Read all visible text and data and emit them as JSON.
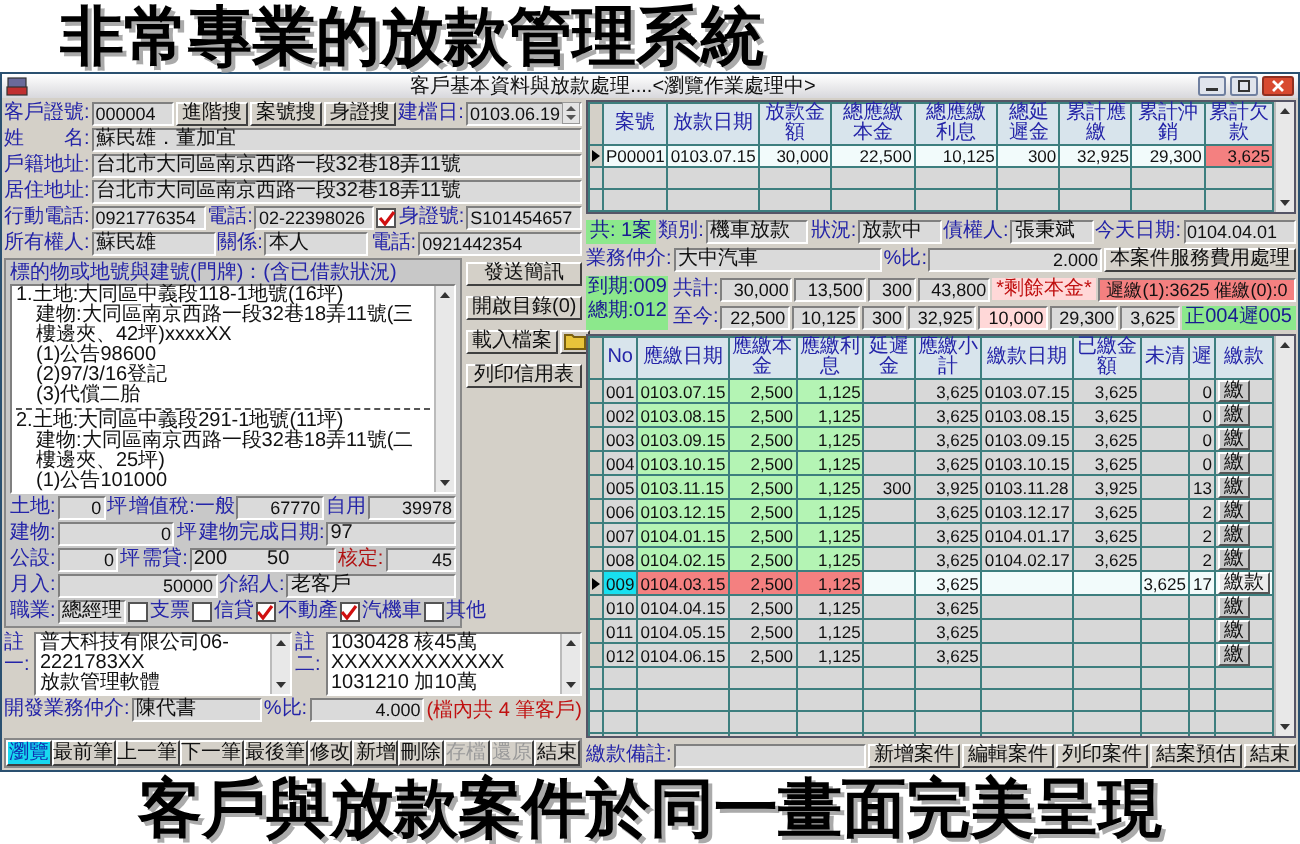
{
  "headline": "非常專業的放款管理系統",
  "window": {
    "title": "客戶基本資料與放款處理....<瀏覽作業處理中>"
  },
  "customer": {
    "rows": [
      [
        {
          "kind": "label",
          "text": "客戶證號:"
        },
        {
          "kind": "code",
          "value": "000004"
        },
        {
          "kind": "button",
          "text": "進階搜"
        },
        {
          "kind": "button",
          "text": "案號搜"
        },
        {
          "kind": "button",
          "text": "身證搜"
        },
        {
          "kind": "label",
          "text": "建檔日:"
        },
        {
          "kind": "spin",
          "value": "0103.06.19"
        }
      ],
      [
        {
          "kind": "label",
          "text": "姓　　名:"
        },
        {
          "kind": "field",
          "value": "蘇民雄．董加宜"
        }
      ],
      [
        {
          "kind": "label",
          "text": "戶籍地址:"
        },
        {
          "kind": "field",
          "value": "台北市大同區南京西路一段32巷18弄11號"
        }
      ],
      [
        {
          "kind": "label",
          "text": "居住地址:"
        },
        {
          "kind": "field",
          "value": "台北市大同區南京西路一段32巷18弄11號"
        }
      ],
      [
        {
          "kind": "label",
          "text": "行動電話:"
        },
        {
          "kind": "code",
          "value": "0921776354"
        },
        {
          "kind": "label",
          "text": "電話:"
        },
        {
          "kind": "code",
          "value": "02-22398026"
        },
        {
          "kind": "check",
          "checked": true
        },
        {
          "kind": "label",
          "text": "身證號:"
        },
        {
          "kind": "code",
          "value": "S101454657"
        }
      ],
      [
        {
          "kind": "label",
          "text": "所有權人:"
        },
        {
          "kind": "field",
          "value": "蘇民雄"
        },
        {
          "kind": "label",
          "text": "關係:"
        },
        {
          "kind": "field",
          "value": "本人"
        },
        {
          "kind": "label",
          "text": "電話:"
        },
        {
          "kind": "code",
          "value": "0921442354"
        }
      ]
    ],
    "property": {
      "title": "標的物或地號與建號(門牌)：(含已借款狀況)",
      "entries": [
        [
          "1.土地:大同區中義段118-1地號(16坪)",
          "建物:大同區南京西路一段32巷18弄11號(三樓邊夾、42坪)xxxxXX",
          "(1)公告98600",
          "(2)97/3/16登記",
          "(3)代償二胎"
        ],
        [
          "2.土地:大同區中義段291-1地號(11坪)",
          "建物:大同區南京西路一段32巷18弄11號(二樓邊夾、25坪)",
          "(1)公告101000"
        ]
      ]
    },
    "side_buttons": [
      [
        {
          "kind": "button",
          "text": "發送簡訊"
        }
      ],
      [
        {
          "kind": "button",
          "text": "開啟目錄(0)"
        }
      ],
      [
        {
          "kind": "button",
          "text": "載入檔案"
        },
        {
          "kind": "folder"
        }
      ],
      [
        {
          "kind": "button",
          "text": "列印信用表"
        }
      ]
    ],
    "details": [
      [
        {
          "kind": "label",
          "text": "土地:"
        },
        {
          "kind": "num",
          "value": "0"
        },
        {
          "kind": "label",
          "text": "坪"
        },
        {
          "kind": "label",
          "text": "增值稅:一般"
        },
        {
          "kind": "num",
          "value": "67770"
        },
        {
          "kind": "label",
          "text": "自用"
        },
        {
          "kind": "num",
          "value": "39978"
        }
      ],
      [
        {
          "kind": "label",
          "text": "建物:"
        },
        {
          "kind": "num",
          "value": "0"
        },
        {
          "kind": "label",
          "text": "坪"
        },
        {
          "kind": "label",
          "text": "建物完成日期:"
        },
        {
          "kind": "field",
          "value": "97"
        }
      ],
      [
        {
          "kind": "label",
          "text": "公設:"
        },
        {
          "kind": "num",
          "value": "0"
        },
        {
          "kind": "label",
          "text": "坪"
        },
        {
          "kind": "label",
          "text": "需貸:"
        },
        {
          "kind": "field",
          "value": "200　　50"
        },
        {
          "kind": "alert-label",
          "text": "核定:"
        },
        {
          "kind": "num",
          "value": "45"
        }
      ],
      [
        {
          "kind": "label",
          "text": "月入:"
        },
        {
          "kind": "num",
          "value": "50000"
        },
        {
          "kind": "label",
          "text": "介紹人:"
        },
        {
          "kind": "field",
          "value": "老客戶"
        }
      ],
      [
        {
          "kind": "label",
          "text": "職業:"
        },
        {
          "kind": "field",
          "value": "總經理"
        },
        {
          "kind": "check",
          "checked": false,
          "text": "支票"
        },
        {
          "kind": "check",
          "checked": false,
          "text": "信貸"
        },
        {
          "kind": "check",
          "checked": true,
          "text": "不動產"
        },
        {
          "kind": "check",
          "checked": true,
          "text": "汽機車"
        },
        {
          "kind": "check",
          "checked": false,
          "text": "其他"
        }
      ]
    ],
    "notes": [
      {
        "label": "註一:",
        "lines": [
          "普大科技有限公司06-2221783XX",
          "放款管理軟體"
        ]
      },
      {
        "label": "註二:",
        "lines": [
          "1030428 核45萬 XXXXXXXXXXXXX",
          "1031210 加10萬"
        ]
      }
    ],
    "broker_row": [
      {
        "kind": "label",
        "text": "開發業務仲介:"
      },
      {
        "kind": "field",
        "value": "陳代書"
      },
      {
        "kind": "label",
        "text": "%比:"
      },
      {
        "kind": "num",
        "value": "4.000"
      },
      {
        "kind": "note",
        "text": "(檔內共 4 筆客戶)"
      }
    ],
    "nav_buttons": [
      {
        "label": "瀏覽",
        "selected": true,
        "disabled": false
      },
      {
        "label": "最前筆",
        "selected": false,
        "disabled": false
      },
      {
        "label": "上一筆",
        "selected": false,
        "disabled": false
      },
      {
        "label": "下一筆",
        "selected": false,
        "disabled": false
      },
      {
        "label": "最後筆",
        "selected": false,
        "disabled": false
      },
      {
        "label": "修改",
        "selected": false,
        "disabled": false
      },
      {
        "label": "新增",
        "selected": false,
        "disabled": false
      },
      {
        "label": "刪除",
        "selected": false,
        "disabled": false
      },
      {
        "label": "存檔",
        "selected": false,
        "disabled": true
      },
      {
        "label": "還原",
        "selected": false,
        "disabled": true
      },
      {
        "label": "結束",
        "selected": false,
        "disabled": false
      }
    ]
  },
  "cases": {
    "columns": [
      "案號",
      "放款日期",
      "放款金額",
      "總應繳本金",
      "總應繳利息",
      "總延遲金",
      "累計應繳",
      "累計沖銷",
      "累計欠款"
    ],
    "rows": [
      {
        "cells": [
          "P00001",
          "0103.07.15",
          "30,000",
          "22,500",
          "10,125",
          "300",
          "32,925",
          "29,300",
          "3,625"
        ],
        "selected": true,
        "in_arrears": true
      }
    ]
  },
  "case_info": [
    [
      {
        "kind": "count",
        "text": "共: 1案"
      },
      {
        "kind": "label",
        "text": "類別:"
      },
      {
        "kind": "field",
        "value": "機車放款"
      },
      {
        "kind": "label",
        "text": "狀況:"
      },
      {
        "kind": "field",
        "value": "放款中"
      },
      {
        "kind": "label",
        "text": "債權人:"
      },
      {
        "kind": "field",
        "value": "張秉斌"
      },
      {
        "kind": "label",
        "text": "今天日期:"
      },
      {
        "kind": "code",
        "value": "0104.04.01"
      }
    ],
    [
      {
        "kind": "label",
        "text": "業務仲介:"
      },
      {
        "kind": "field",
        "value": "大中汽車"
      },
      {
        "kind": "label",
        "text": "%比:"
      },
      {
        "kind": "num",
        "value": "2.000"
      },
      {
        "kind": "button",
        "text": "本案件服務費用處理"
      }
    ]
  ],
  "totals": {
    "period": [
      "到期:009",
      "總期:012"
    ],
    "rows": [
      [
        {
          "kind": "label",
          "text": "共計:"
        },
        {
          "kind": "num",
          "value": "30,000"
        },
        {
          "kind": "num",
          "value": "13,500"
        },
        {
          "kind": "num",
          "value": "300"
        },
        {
          "kind": "num",
          "value": "43,800"
        },
        {
          "kind": "pink-label",
          "text": "*剩餘本金*"
        },
        {
          "kind": "alert",
          "value": "遲繳(1):3625 催繳(0):0"
        }
      ],
      [
        {
          "kind": "label",
          "text": "至今:"
        },
        {
          "kind": "num",
          "value": "22,500"
        },
        {
          "kind": "num",
          "value": "10,125"
        },
        {
          "kind": "num",
          "value": "300"
        },
        {
          "kind": "num",
          "value": "32,925"
        },
        {
          "kind": "pink",
          "value": "10,000"
        },
        {
          "kind": "num",
          "value": "29,300"
        },
        {
          "kind": "num",
          "value": "3,625"
        },
        {
          "kind": "count",
          "text": "正004遲005"
        }
      ]
    ]
  },
  "schedule": {
    "columns": [
      "No",
      "應繳日期",
      "應繳本金",
      "應繳利息",
      "延遲金",
      "應繳小計",
      "繳款日期",
      "已繳金額",
      "未清",
      "遲",
      "繳款"
    ],
    "rows": [
      {
        "no": "001",
        "due_date": "0103.07.15",
        "principal": "2,500",
        "interest": "1,125",
        "subtotal": "3,625",
        "paid_date": "0103.07.15",
        "paid_amount": "3,625",
        "late_days": "0",
        "button": "繳",
        "paid": true,
        "selected": false
      },
      {
        "no": "002",
        "due_date": "0103.08.15",
        "principal": "2,500",
        "interest": "1,125",
        "subtotal": "3,625",
        "paid_date": "0103.08.15",
        "paid_amount": "3,625",
        "late_days": "0",
        "button": "繳",
        "paid": true,
        "selected": false
      },
      {
        "no": "003",
        "due_date": "0103.09.15",
        "principal": "2,500",
        "interest": "1,125",
        "subtotal": "3,625",
        "paid_date": "0103.09.15",
        "paid_amount": "3,625",
        "late_days": "0",
        "button": "繳",
        "paid": true,
        "selected": false
      },
      {
        "no": "004",
        "due_date": "0103.10.15",
        "principal": "2,500",
        "interest": "1,125",
        "subtotal": "3,625",
        "paid_date": "0103.10.15",
        "paid_amount": "3,625",
        "late_days": "0",
        "button": "繳",
        "paid": true,
        "selected": false
      },
      {
        "no": "005",
        "due_date": "0103.11.15",
        "principal": "2,500",
        "interest": "1,125",
        "late_fee": "300",
        "subtotal": "3,925",
        "paid_date": "0103.11.28",
        "paid_amount": "3,925",
        "late_days": "13",
        "button": "繳",
        "paid": true,
        "selected": false
      },
      {
        "no": "006",
        "due_date": "0103.12.15",
        "principal": "2,500",
        "interest": "1,125",
        "subtotal": "3,625",
        "paid_date": "0103.12.17",
        "paid_amount": "3,625",
        "late_days": "2",
        "button": "繳",
        "paid": true,
        "selected": false
      },
      {
        "no": "007",
        "due_date": "0104.01.15",
        "principal": "2,500",
        "interest": "1,125",
        "subtotal": "3,625",
        "paid_date": "0104.01.17",
        "paid_amount": "3,625",
        "late_days": "2",
        "button": "繳",
        "paid": true,
        "selected": false
      },
      {
        "no": "008",
        "due_date": "0104.02.15",
        "principal": "2,500",
        "interest": "1,125",
        "subtotal": "3,625",
        "paid_date": "0104.02.17",
        "paid_amount": "3,625",
        "late_days": "2",
        "button": "繳",
        "paid": true,
        "selected": false
      },
      {
        "no": "009",
        "due_date": "0104.03.15",
        "principal": "2,500",
        "interest": "1,125",
        "subtotal": "3,625",
        "outstanding": "3,625",
        "late_days": "17",
        "button": "繳款",
        "paid": false,
        "selected": true
      },
      {
        "no": "010",
        "due_date": "0104.04.15",
        "principal": "2,500",
        "interest": "1,125",
        "subtotal": "3,625",
        "button": "繳",
        "paid": false,
        "selected": false
      },
      {
        "no": "011",
        "due_date": "0104.05.15",
        "principal": "2,500",
        "interest": "1,125",
        "subtotal": "3,625",
        "button": "繳",
        "paid": false,
        "selected": false
      },
      {
        "no": "012",
        "due_date": "0104.06.15",
        "principal": "2,500",
        "interest": "1,125",
        "subtotal": "3,625",
        "button": "繳",
        "paid": false,
        "selected": false
      }
    ]
  },
  "footer": [
    {
      "kind": "label",
      "text": "繳款備註:"
    },
    {
      "kind": "field"
    },
    {
      "kind": "button",
      "text": "新增案件"
    },
    {
      "kind": "button",
      "text": "編輯案件"
    },
    {
      "kind": "button",
      "text": "列印案件"
    },
    {
      "kind": "button",
      "text": "結案預估"
    },
    {
      "kind": "button",
      "text": "結束"
    }
  ],
  "tagline": "客戶與放款案件於同一畫面完美呈現"
}
